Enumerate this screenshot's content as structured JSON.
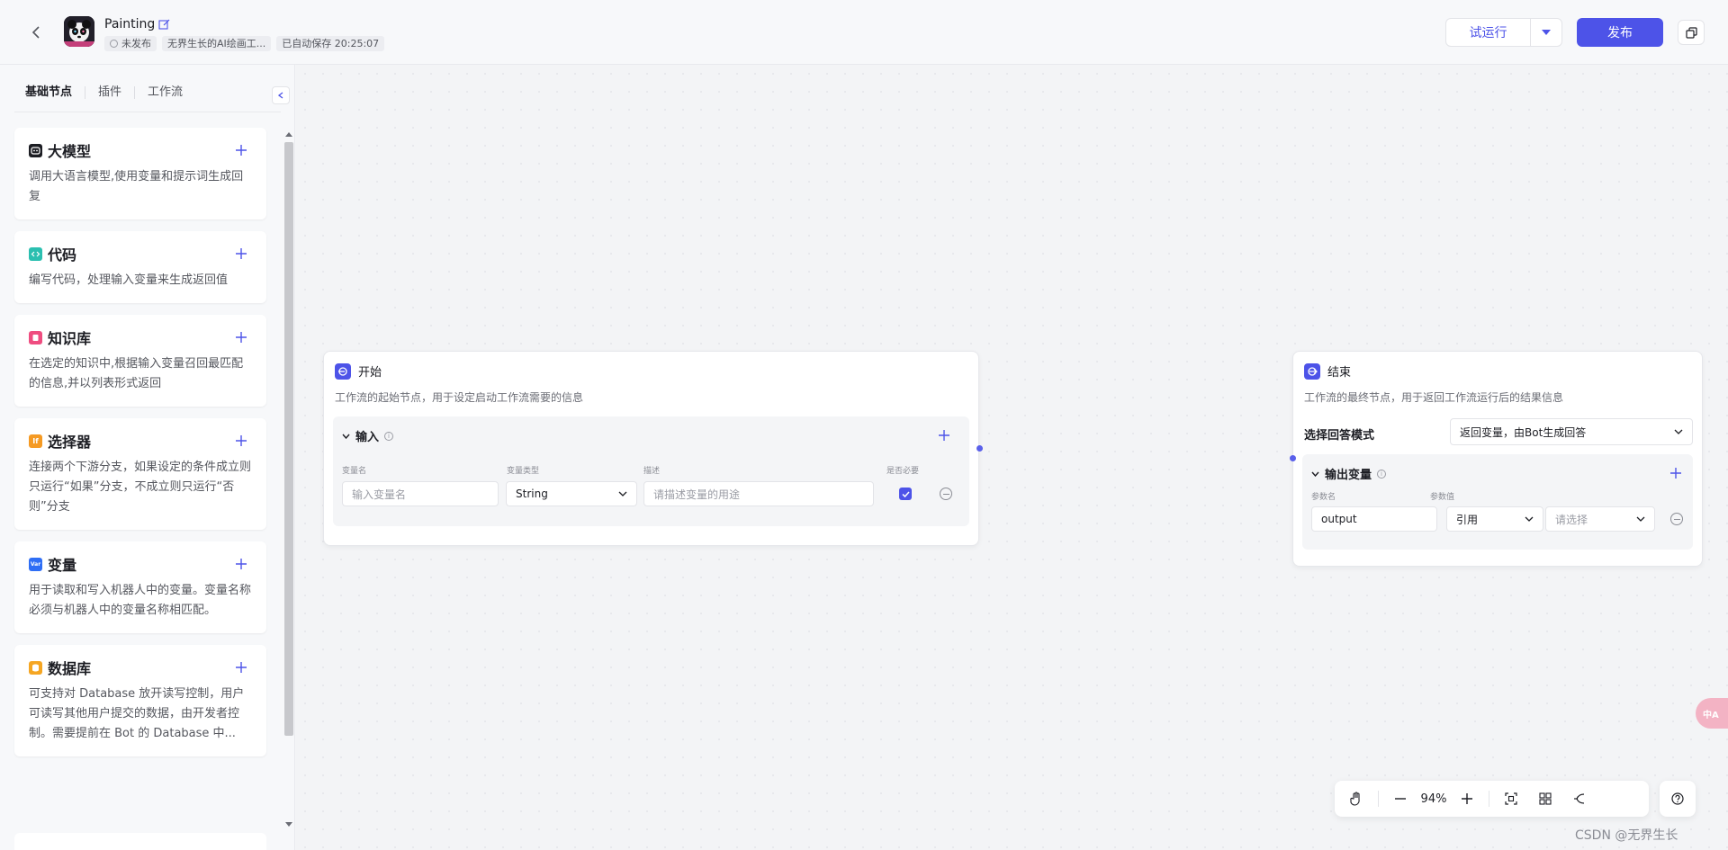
{
  "header": {
    "app_title": "Painting",
    "status": "未发布",
    "author": "无界生长的AI绘画工...",
    "autosave": "已自动保存 20:25:07",
    "trial_run_label": "试运行",
    "publish_label": "发布"
  },
  "sidebar": {
    "tabs": [
      {
        "label": "基础节点",
        "active": true
      },
      {
        "label": "插件",
        "active": false
      },
      {
        "label": "工作流",
        "active": false
      }
    ],
    "nodes": [
      {
        "title": "大模型",
        "desc": "调用大语言模型,使用变量和提示词生成回复",
        "icon": "llm-icon",
        "color": "#1c1d23"
      },
      {
        "title": "代码",
        "desc": "编写代码，处理输入变量来生成返回值",
        "icon": "code-icon",
        "color": "#2bbfb0"
      },
      {
        "title": "知识库",
        "desc": "在选定的知识中,根据输入变量召回最匹配的信息,并以列表形式返回",
        "icon": "knowledge-icon",
        "color": "#ef4d80"
      },
      {
        "title": "选择器",
        "desc": "连接两个下游分支，如果设定的条件成立则只运行“如果”分支，不成立则只运行“否则”分支",
        "icon": "condition-icon",
        "color": "#f59a23"
      },
      {
        "title": "变量",
        "desc": "用于读取和写入机器人中的变量。变量名称必须与机器人中的变量名称相匹配。",
        "icon": "variable-icon",
        "color": "#2f6ef5"
      },
      {
        "title": "数据库",
        "desc": "可支持对 Database 放开读写控制，用户可读写其他用户提交的数据，由开发者控制。需要提前在 Bot 的 Database 中...",
        "icon": "database-icon",
        "color": "#f5a623"
      }
    ]
  },
  "start_node": {
    "title": "开始",
    "desc": "工作流的起始节点，用于设定启动工作流需要的信息",
    "section_title": "输入",
    "col_name": "变量名",
    "col_type": "变量类型",
    "col_desc": "描述",
    "col_required": "是否必要",
    "name_placeholder": "输入变量名",
    "type_value": "String",
    "desc_placeholder": "请描述变量的用途",
    "required": true
  },
  "end_node": {
    "title": "结束",
    "desc": "工作流的最终节点，用于返回工作流运行后的结果信息",
    "mode_label": "选择回答模式",
    "mode_value": "返回变量，由Bot生成回答",
    "section_title": "输出变量",
    "col_name": "参数名",
    "col_value": "参数值",
    "param_name": "output",
    "ref_type": "引用",
    "select_placeholder": "请选择"
  },
  "toolbar": {
    "zoom": "94%"
  },
  "float_badge": "中A",
  "watermark": "CSDN @无界生长"
}
